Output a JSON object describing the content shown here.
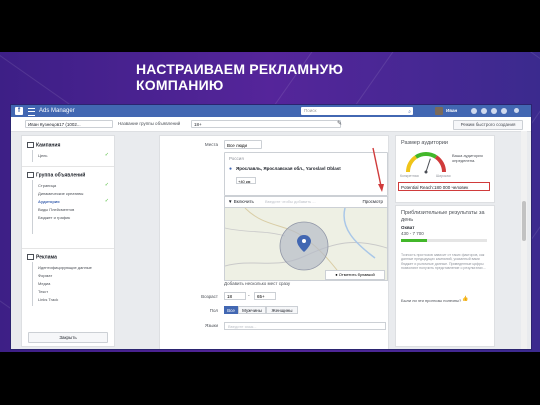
{
  "slide": {
    "title": "НАСТРАИВАЕМ РЕКЛАМНУЮ КОМПАНИЮ"
  },
  "topbar": {
    "app_title": "Ads Manager",
    "search_placeholder": "Поиск",
    "user_name": "Иван",
    "logo_glyph": "f"
  },
  "subbar": {
    "campaign_select": "Иван Кузнецов17 (1002...",
    "adset_name_label": "Название группы объявлений",
    "adset_name_value": "18+",
    "quick_create": "Режим быстрого создания"
  },
  "sidebar": {
    "campaign_header": "Кампания",
    "campaign_items": [
      "Цель"
    ],
    "adset_header": "Группа объявлений",
    "adset_items": [
      "Страница",
      "Динамические креативы",
      "Аудитория",
      "Виды Плейсментов",
      "Бюджет и график"
    ],
    "active_adset_item": "Аудитория",
    "ad_header": "Реклама",
    "ad_items": [
      "Идентифицирующие данные",
      "Формат",
      "Медиа",
      "Текст",
      "Links Track"
    ],
    "close_button": "Закрыть"
  },
  "targeting": {
    "places_label": "Места",
    "places_value": "Все люди",
    "location_country": "Россия",
    "location_name": "Ярославль, Ярославская обл., Yaroslavl Oblast",
    "radius": "+40 км",
    "include_option": "Включить",
    "location_search_placeholder": "Введите чтобы добавить ...",
    "browse_link": "Просмотр",
    "drop_pin": "Отметить булавкой",
    "bulk_add": "Добавить несколько мест сразу",
    "age_label": "Возраст",
    "age_from": "18",
    "age_to": "65+",
    "age_dash": "-",
    "gender_label": "Пол",
    "gender_options": [
      "Все",
      "Мужчины",
      "Женщины"
    ],
    "gender_selected": "Все",
    "language_label": "Языки",
    "language_placeholder": "Введите язык..."
  },
  "audience": {
    "title": "Размер аудитории",
    "definition": "Ваша аудитория определена.",
    "gauge_labels": [
      "Конкретная",
      "Широкая"
    ],
    "gauge_level": 0.6,
    "potential_reach": "Potential Reach:180 000 человек"
  },
  "results": {
    "title": "Приблизительные результаты за",
    "days": "день",
    "reach_label": "Охват",
    "reach_value": "430 - 7 700",
    "bar_fill": 0.3,
    "disclaimer": "Точность прогнозов зависит от таких факторов, как данные предыдущих кампаний, указанный вами бюджет и рыночные данные. Приведенные цифры позволяют получить представление о результатах...",
    "question": "Были ли эти прогнозы полезны?",
    "thumb_icon": "thumbs-up-icon"
  },
  "colors": {
    "facebook_blue": "#4267b2",
    "slide_purple": "#4a2591",
    "highlight_red": "#d03b3b",
    "gauge_green": "#42b72a"
  }
}
